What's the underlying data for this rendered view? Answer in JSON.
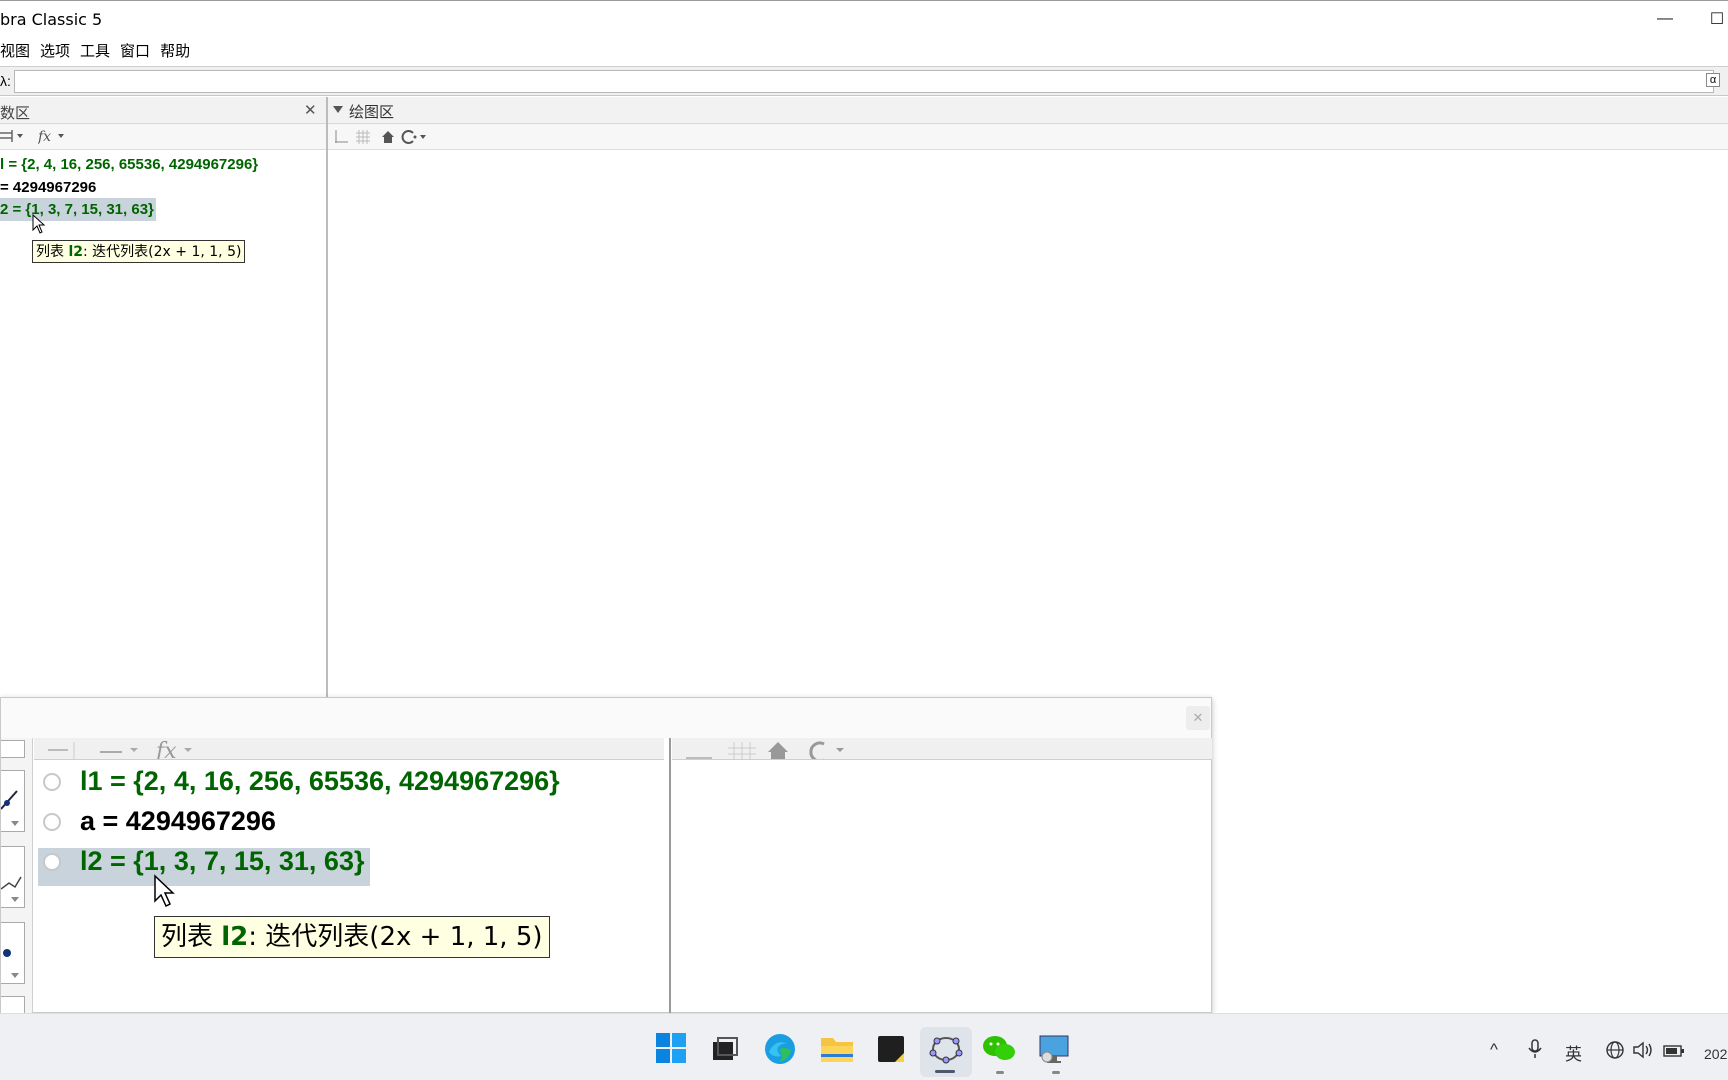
{
  "window": {
    "title": "bra Classic 5",
    "minimize_glyph": "—",
    "maximize_glyph": "☐"
  },
  "menu": [
    "视图",
    "选项",
    "工具",
    "窗口",
    "帮助"
  ],
  "input_bar": {
    "label": "λ:",
    "value": "",
    "alpha": "α"
  },
  "algebra_view": {
    "title": "数区",
    "close_glyph": "✕",
    "rows": [
      {
        "text": "l = {2, 4, 16, 256, 65536, 4294967296}",
        "color": "#006400"
      },
      {
        "text": "= 4294967296",
        "color": "#000000"
      },
      {
        "text": "2 = {1, 3, 7, 15, 31, 63}",
        "color": "#006400",
        "selected": true
      }
    ],
    "tooltip": {
      "prefix": "列表 ",
      "name": "l2",
      "suffix": ": 迭代列表(2x + 1, 1, 5)"
    }
  },
  "graphics_view": {
    "title": "绘图区"
  },
  "zoom_overlay": {
    "rows": [
      {
        "text": "l1 = {2, 4, 16, 256, 65536, 4294967296}",
        "color": "#006400"
      },
      {
        "text": "a = 4294967296",
        "color": "#000000"
      },
      {
        "text": "l2 = {1, 3, 7, 15, 31, 63}",
        "color": "#006400",
        "selected": true
      }
    ],
    "tooltip": {
      "prefix": "列表 ",
      "name": "l2",
      "suffix": ": 迭代列表(2x + 1, 1, 5)"
    },
    "close_glyph": "✕"
  },
  "taskbar": {
    "apps": [
      "start-icon",
      "task-view-icon",
      "edge-icon",
      "file-explorer-icon",
      "sticky-notes-icon",
      "geogebra-icon",
      "wechat-icon",
      "remote-desktop-icon"
    ],
    "tray": {
      "chevron": "^",
      "mic": "🎙",
      "ime": "英",
      "network": "⊕",
      "volume": "🔊",
      "battery": "▭",
      "clock": "202"
    }
  },
  "colors": {
    "list_green": "#006400",
    "selection_bg": "#c9d3dc",
    "tooltip_bg": "#ffffe1",
    "accent_blue": "#0078d4"
  }
}
